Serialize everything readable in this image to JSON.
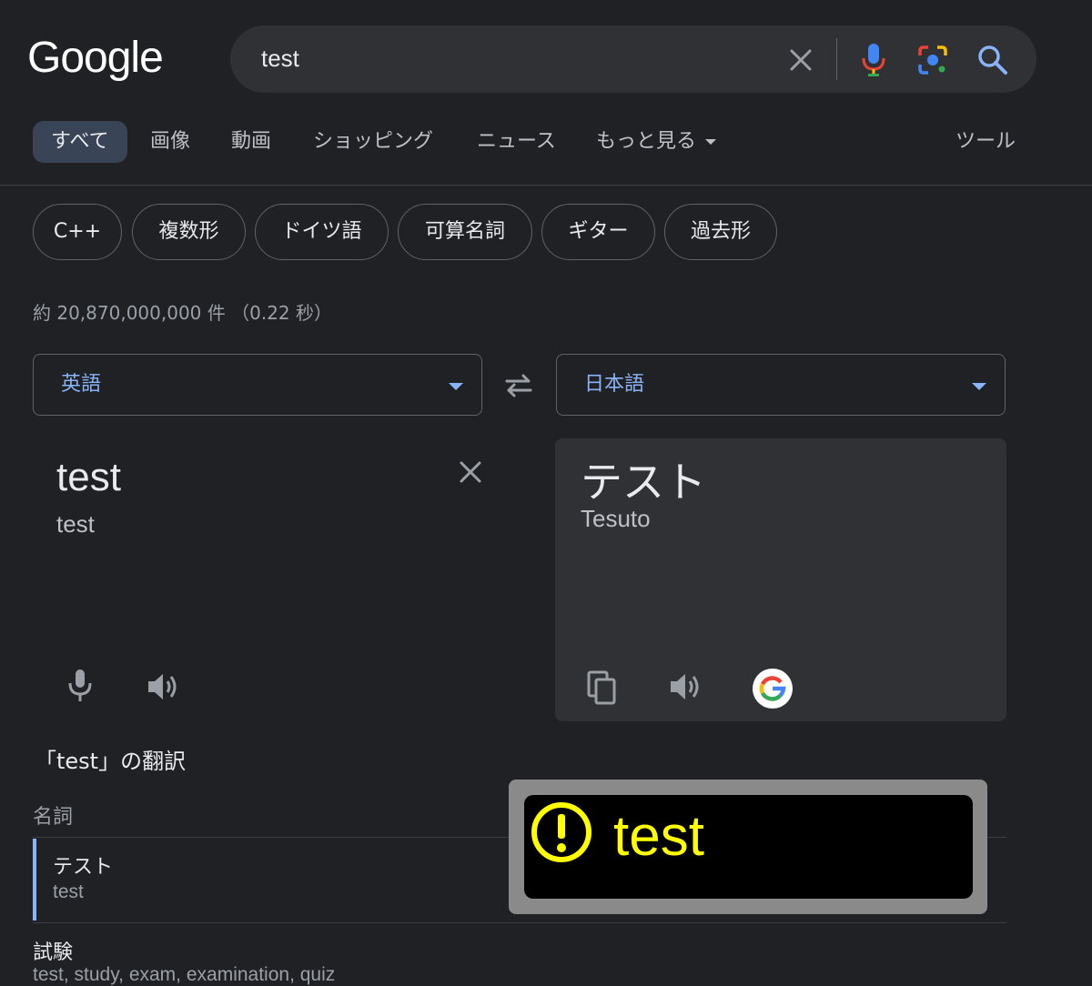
{
  "logo": "Google",
  "search": {
    "query": "test"
  },
  "tabs": [
    {
      "label": "すべて",
      "active": true
    },
    {
      "label": "画像"
    },
    {
      "label": "動画"
    },
    {
      "label": "ショッピング"
    },
    {
      "label": "ニュース"
    },
    {
      "label": "もっと見る"
    }
  ],
  "tools_label": "ツール",
  "chips": [
    "C++",
    "複数形",
    "ドイツ語",
    "可算名詞",
    "ギター",
    "過去形"
  ],
  "result_stats": "約 20,870,000,000 件 （0.22 秒）",
  "translate": {
    "source_lang": "英語",
    "target_lang": "日本語",
    "source_text": "test",
    "source_translit": "test",
    "target_text": "テスト",
    "target_translit": "Tesuto"
  },
  "translations": {
    "title": "「test」の翻訳",
    "pos": "名詞",
    "entries": [
      {
        "word": "テスト",
        "synonyms": "test"
      },
      {
        "word": "試験",
        "synonyms": "test, study, exam, examination, quiz"
      }
    ]
  },
  "overlay": {
    "text": "test",
    "icon": "warning-circle-icon"
  },
  "colors": {
    "background": "#202124",
    "accent": "#8ab4f8",
    "active_tab": "#394457",
    "overlay_text": "#ffff00"
  }
}
